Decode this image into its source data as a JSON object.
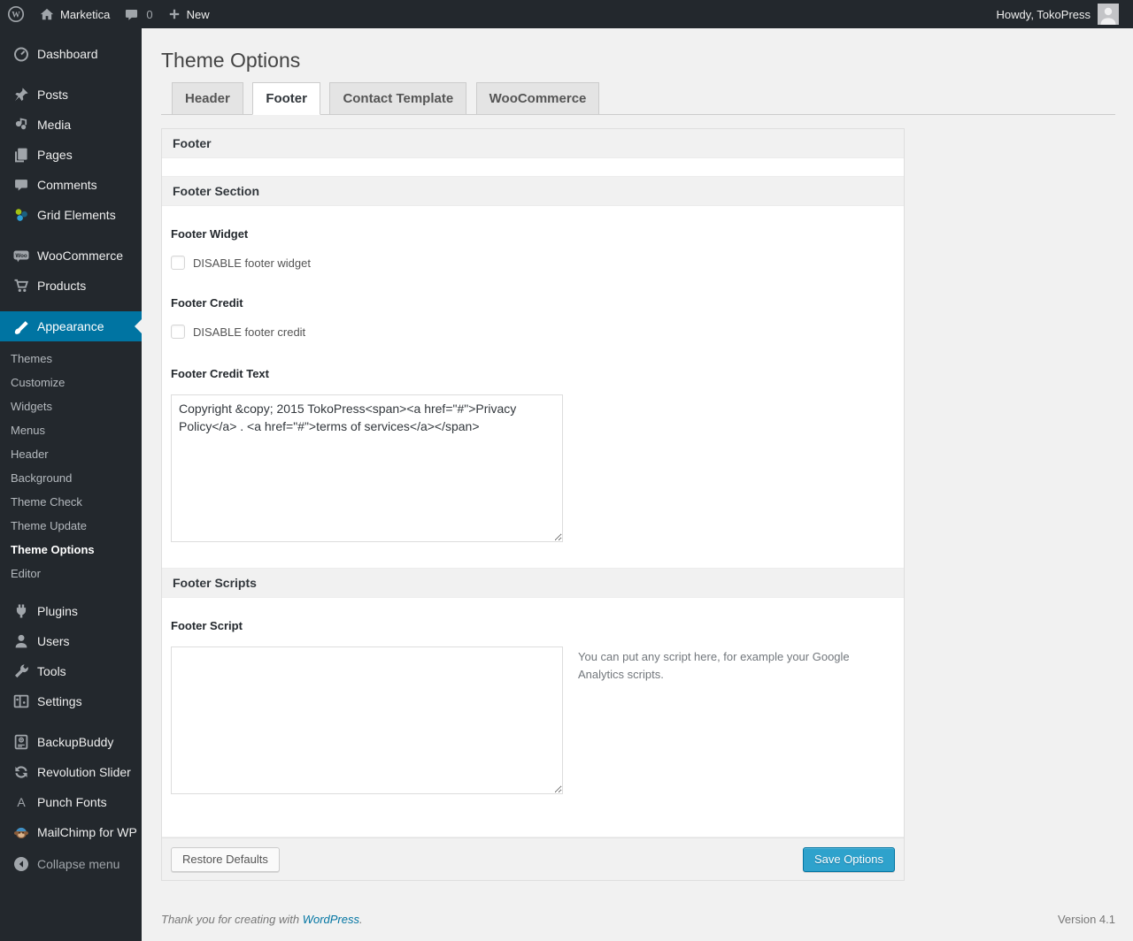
{
  "admin_bar": {
    "site_name": "Marketica",
    "comments_count": "0",
    "new_label": "New",
    "howdy": "Howdy, TokoPress"
  },
  "icons": {
    "wp_logo_letter": "W",
    "woo_badge_text": "Woo",
    "punch_fonts_letter": "A"
  },
  "sidebar": {
    "items": [
      {
        "label": "Dashboard"
      },
      {
        "label": "Posts"
      },
      {
        "label": "Media"
      },
      {
        "label": "Pages"
      },
      {
        "label": "Comments"
      },
      {
        "label": "Grid Elements"
      },
      {
        "label": "WooCommerce"
      },
      {
        "label": "Products"
      },
      {
        "label": "Appearance"
      },
      {
        "label": "Plugins"
      },
      {
        "label": "Users"
      },
      {
        "label": "Tools"
      },
      {
        "label": "Settings"
      },
      {
        "label": "BackupBuddy"
      },
      {
        "label": "Revolution Slider"
      },
      {
        "label": "Punch Fonts"
      },
      {
        "label": "MailChimp for WP"
      },
      {
        "label": "Collapse menu"
      }
    ],
    "appearance_submenu": [
      {
        "label": "Themes"
      },
      {
        "label": "Customize"
      },
      {
        "label": "Widgets"
      },
      {
        "label": "Menus"
      },
      {
        "label": "Header"
      },
      {
        "label": "Background"
      },
      {
        "label": "Theme Check"
      },
      {
        "label": "Theme Update"
      },
      {
        "label": "Theme Options"
      },
      {
        "label": "Editor"
      }
    ]
  },
  "page": {
    "title": "Theme Options",
    "tabs": [
      {
        "label": "Header"
      },
      {
        "label": "Footer"
      },
      {
        "label": "Contact Template"
      },
      {
        "label": "WooCommerce"
      }
    ]
  },
  "panel": {
    "footer_header": "Footer",
    "footer_section_header": "Footer Section",
    "footer_widget_label": "Footer Widget",
    "footer_widget_checkbox_label": "DISABLE footer widget",
    "footer_credit_label": "Footer Credit",
    "footer_credit_checkbox_label": "DISABLE footer credit",
    "footer_credit_text_label": "Footer Credit Text",
    "footer_credit_text_value": "Copyright &copy; 2015 TokoPress<span><a href=\"#\">Privacy Policy</a> . <a href=\"#\">terms of services</a></span>",
    "footer_scripts_header": "Footer Scripts",
    "footer_script_label": "Footer Script",
    "footer_script_value": "",
    "footer_script_hint": "You can put any script here, for example your Google Analytics scripts.",
    "restore_defaults_button": "Restore Defaults",
    "save_options_button": "Save Options"
  },
  "page_footer": {
    "thanks_text": "Thank you for creating with",
    "wordpress_link": "WordPress",
    "suffix": ".",
    "version": "Version 4.1"
  },
  "colors": {
    "accent": "#0074a2",
    "primary_button": "#2ea2cc",
    "admin_dark": "#23282d"
  }
}
